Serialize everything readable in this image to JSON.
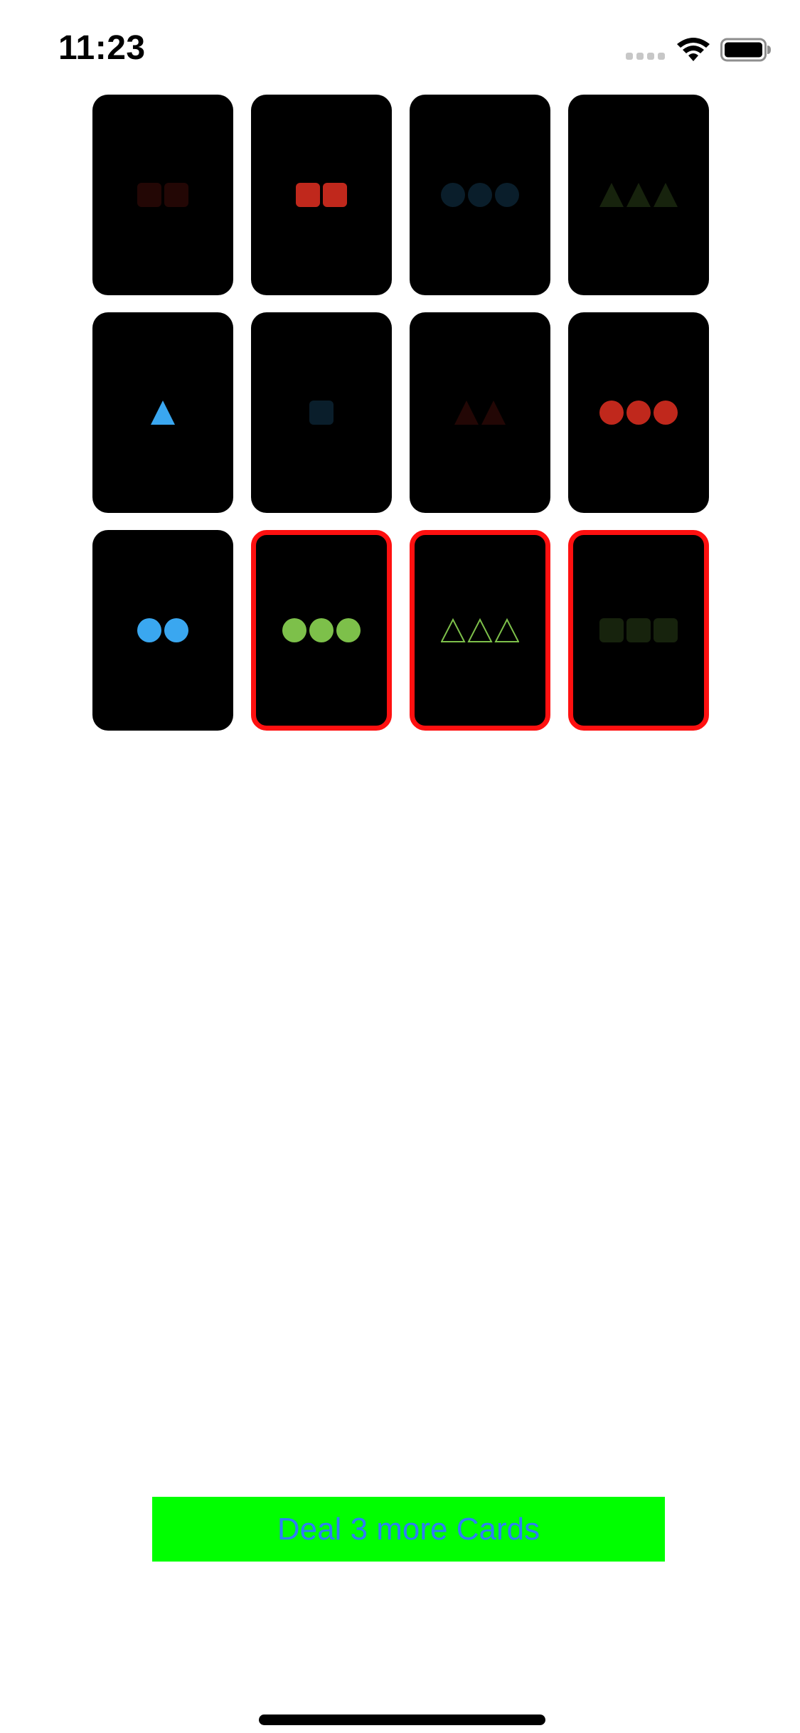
{
  "status_bar": {
    "time": "11:23",
    "signal_icon": "cellular-signal-icon",
    "wifi_icon": "wifi-icon",
    "battery_icon": "battery-icon"
  },
  "cards": [
    {
      "count": 2,
      "shape": "square",
      "fill": "solid",
      "color": "#c0281c",
      "opacity": 0.18,
      "selected": false
    },
    {
      "count": 2,
      "shape": "square",
      "fill": "solid",
      "color": "#c0281c",
      "opacity": 1.0,
      "selected": false
    },
    {
      "count": 3,
      "shape": "circle",
      "fill": "solid",
      "color": "#3aa7f0",
      "opacity": 0.18,
      "selected": false
    },
    {
      "count": 3,
      "shape": "triangle",
      "fill": "solid",
      "color": "#7dc04a",
      "opacity": 0.18,
      "selected": false
    },
    {
      "count": 1,
      "shape": "triangle",
      "fill": "solid",
      "color": "#3aa7f0",
      "opacity": 1.0,
      "selected": false
    },
    {
      "count": 1,
      "shape": "square",
      "fill": "solid",
      "color": "#3aa7f0",
      "opacity": 0.18,
      "selected": false
    },
    {
      "count": 2,
      "shape": "triangle",
      "fill": "solid",
      "color": "#c0281c",
      "opacity": 0.18,
      "selected": false
    },
    {
      "count": 3,
      "shape": "circle",
      "fill": "solid",
      "color": "#c0281c",
      "opacity": 1.0,
      "selected": false
    },
    {
      "count": 2,
      "shape": "circle",
      "fill": "solid",
      "color": "#3aa7f0",
      "opacity": 1.0,
      "selected": false
    },
    {
      "count": 3,
      "shape": "circle",
      "fill": "solid",
      "color": "#7dc04a",
      "opacity": 1.0,
      "selected": true
    },
    {
      "count": 3,
      "shape": "triangle",
      "fill": "outline",
      "color": "#7dc04a",
      "opacity": 1.0,
      "selected": true
    },
    {
      "count": 3,
      "shape": "square",
      "fill": "solid",
      "color": "#7dc04a",
      "opacity": 0.18,
      "selected": true
    }
  ],
  "colors": {
    "selection_border": "#ff1010",
    "card_background": "#000000",
    "button_background": "#00ff00",
    "button_text": "#2f7cf6"
  },
  "deal_button": {
    "label": "Deal 3 more Cards"
  }
}
